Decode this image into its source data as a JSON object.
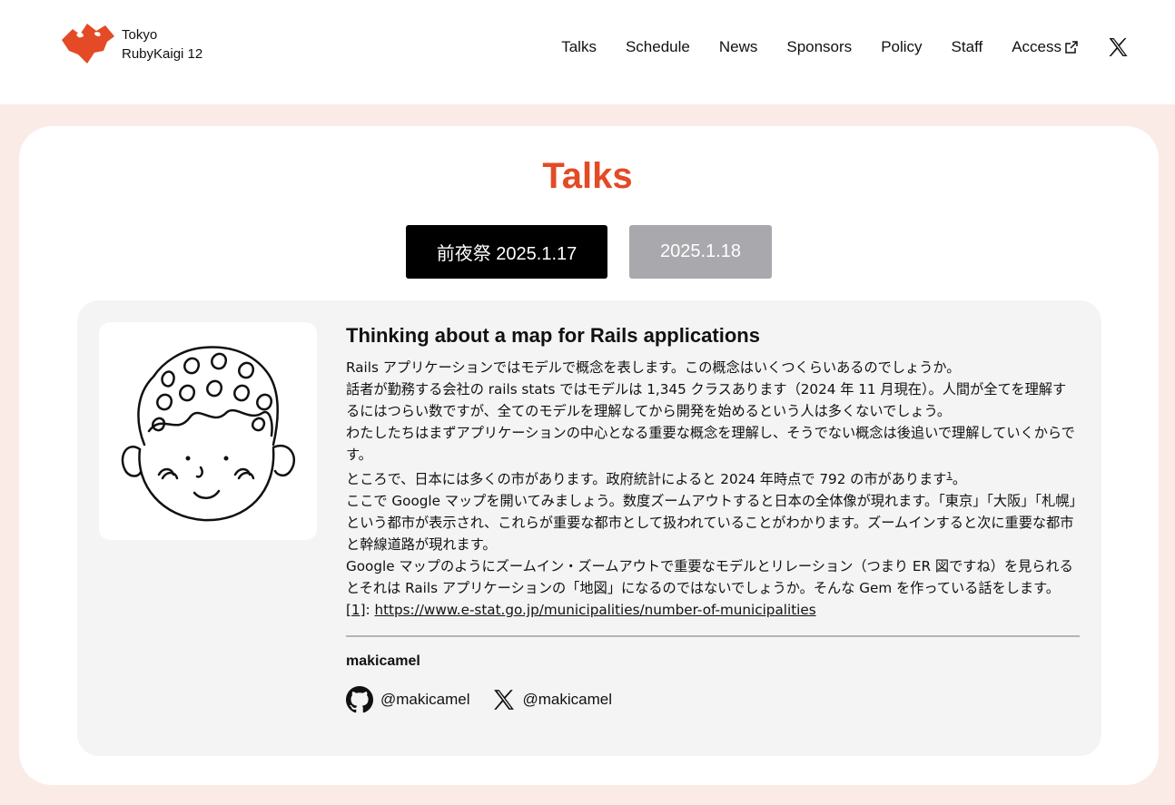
{
  "header": {
    "logo_line1": "Tokyo",
    "logo_line2": "RubyKaigi 12",
    "brand_color": "#e34a25",
    "nav": [
      {
        "label": "Talks"
      },
      {
        "label": "Schedule"
      },
      {
        "label": "News"
      },
      {
        "label": "Sponsors"
      },
      {
        "label": "Policy"
      },
      {
        "label": "Staff"
      },
      {
        "label": "Access"
      }
    ],
    "social_icon": "x-icon"
  },
  "page": {
    "title": "Talks",
    "tabs": [
      {
        "label": "前夜祭 2025.1.17",
        "active": true
      },
      {
        "label": "2025.1.18",
        "active": false
      }
    ]
  },
  "talk": {
    "title": "Thinking about a map for Rails applications",
    "paragraphs": [
      "Rails アプリケーションではモデルで概念を表します。この概念はいくつくらいあるのでしょうか。",
      "話者が勤務する会社の rails stats ではモデルは 1,345 クラスあります（2024 年 11 月現在）。人間が全てを理解するにはつらい数ですが、全てのモデルを理解してから開発を始めるという人は多くないでしょう。",
      "わたしたちはまずアプリケーションの中心となる重要な概念を理解し、そうでない概念は後追いで理解していくからです。",
      "ところで、日本には多くの市があります。政府統計によると 2024 年時点で 792 の市があります",
      "ここで Google マップを開いてみましょう。数度ズームアウトすると日本の全体像が現れます。「東京」「大阪」「札幌」という都市が表示され、これらが重要な都市として扱われていることがわかります。ズームインすると次に重要な都市と幹線道路が現れます。",
      "Google マップのようにズームイン・ズームアウトで重要なモデルとリレーション（つまり ER 図ですね）を見られるとそれは Rails アプリケーションの「地図」になるのではないでしょうか。そんな Gem を作っている話をします。"
    ],
    "footnote_ref": "1",
    "footnote_period": "。",
    "footnote_label": "[1]",
    "footnote_sep": ": ",
    "footnote_url": "https://www.e-stat.go.jp/municipalities/number-of-municipalities",
    "speaker": "makicamel",
    "github_handle": "@makicamel",
    "x_handle": "@makicamel"
  }
}
